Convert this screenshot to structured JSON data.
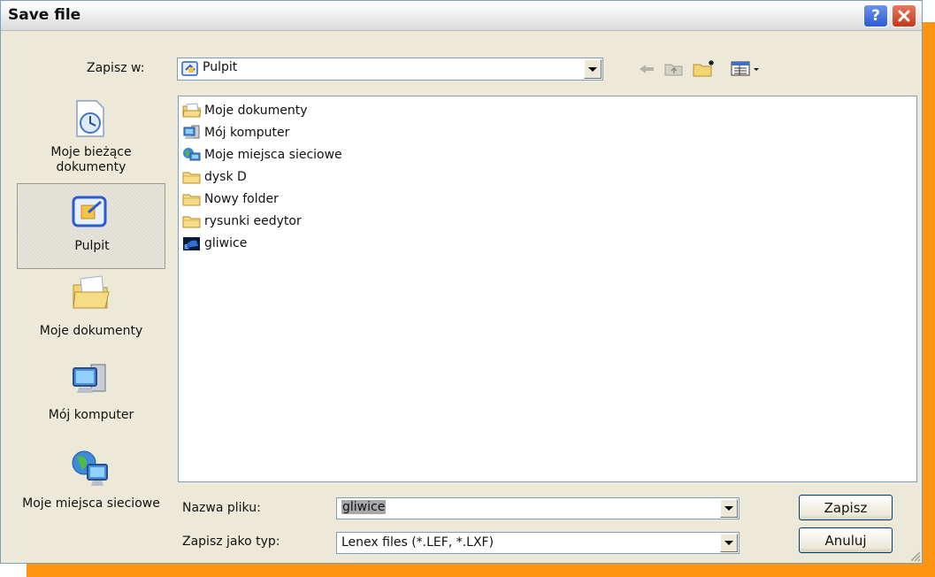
{
  "dialog": {
    "title": "Save file"
  },
  "toolbar": {
    "save_in_label": "Zapisz w:",
    "save_in_value": "Pulpit"
  },
  "places": [
    {
      "label": "Moje bieżące dokumenty",
      "icon": "recent-documents-icon"
    },
    {
      "label": "Pulpit",
      "icon": "desktop-icon"
    },
    {
      "label": "Moje dokumenty",
      "icon": "my-documents-icon"
    },
    {
      "label": "Mój komputer",
      "icon": "my-computer-icon"
    },
    {
      "label": "Moje miejsca sieciowe",
      "icon": "network-places-icon"
    }
  ],
  "files": [
    {
      "name": "Moje dokumenty",
      "icon": "my-documents-icon"
    },
    {
      "name": "Mój komputer",
      "icon": "my-computer-icon"
    },
    {
      "name": "Moje miejsca sieciowe",
      "icon": "network-places-icon"
    },
    {
      "name": "dysk D",
      "icon": "folder-icon"
    },
    {
      "name": "Nowy folder",
      "icon": "folder-icon"
    },
    {
      "name": "rysunki eedytor",
      "icon": "folder-icon"
    },
    {
      "name": "gliwice",
      "icon": "lenex-file-icon"
    }
  ],
  "form": {
    "filename_label": "Nazwa pliku:",
    "filename_value": "gliwice",
    "filetype_label": "Zapisz jako typ:",
    "filetype_value": "Lenex files (*.LEF, *.LXF)"
  },
  "buttons": {
    "save": "Zapisz",
    "cancel": "Anuluj"
  },
  "colors": {
    "accent": "#ff9410",
    "selection": "#a8a8a8"
  }
}
